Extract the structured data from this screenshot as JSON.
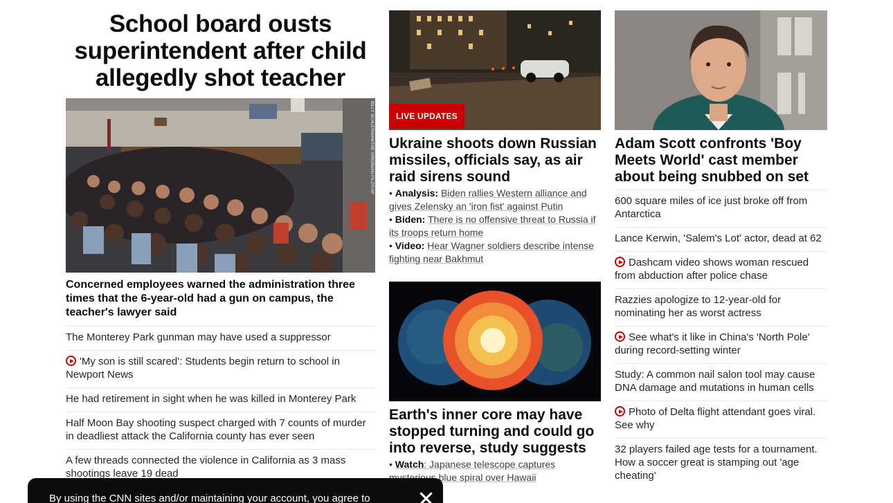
{
  "lead": {
    "headline": "School board ousts superintendent after child allegedly shot teacher",
    "photo_credit": "BILLY SCHUERMAN/THE VIRGINIAN-PILOT/AP",
    "subhead": "Concerned employees warned the administration three times that the 6-year-old had a gun on campus, the teacher's lawyer said",
    "links": [
      {
        "text": "The Monterey Park gunman may have used a suppressor",
        "video": false
      },
      {
        "text": "'My son is still scared': Students begin return to school in Newport News",
        "video": true
      },
      {
        "text": "He had retirement in sight when he was killed in Monterey Park",
        "video": false
      },
      {
        "text": "Half Moon Bay shooting suspect charged with 7 counts of murder in deadliest attack the California county has ever seen",
        "video": false
      },
      {
        "text": "A few threads connected the violence in California as 3 mass shootings leave 19 dead",
        "video": false
      }
    ]
  },
  "ukraine": {
    "badge": "LIVE UPDATES",
    "headline": "Ukraine shoots down Russian missiles, officials say, as air raid sirens sound",
    "bullets": [
      {
        "label": "Analysis:",
        "text": "Biden rallies Western alliance and gives Zelensky an 'iron fist' against Putin"
      },
      {
        "label": "Biden:",
        "text": "There is no offensive threat to Russia if its troops return home"
      },
      {
        "label": "Video:",
        "text": "Hear Wagner soldiers describe intense fighting near Bakhmut"
      }
    ]
  },
  "earth": {
    "headline": "Earth's inner core may have stopped turning and could go into reverse, study suggests",
    "bullet_label": "Watch",
    "bullet_text": ": Japanese telescope captures mysterious blue spiral over Hawaii"
  },
  "scott": {
    "headline": "Adam Scott confronts 'Boy Meets World' cast member about being snubbed on set",
    "links": [
      {
        "text": "600 square miles of ice just broke off from Antarctica",
        "video": false
      },
      {
        "text": "Lance Kerwin, 'Salem's Lot' actor, dead at 62",
        "video": false
      },
      {
        "text": "Dashcam video shows woman rescued from abduction after police chase",
        "video": true
      },
      {
        "text": "Razzies apologize to 12-year-old for nominating her as worst actress",
        "video": false
      },
      {
        "text": "See what's it like in China's 'North Pole' during record-setting winter",
        "video": true
      },
      {
        "text": "Study: A common nail salon tool may cause DNA damage and mutations in human cells",
        "video": false
      },
      {
        "text": "Photo of Delta flight attendant goes viral. See why",
        "video": true
      },
      {
        "text": "32 players failed age tests for a tournament. How a soccer great is stamping out 'age cheating'",
        "video": false
      }
    ]
  },
  "cookie_banner": {
    "text": "By using the CNN sites and/or maintaining your account, you agree to"
  },
  "colors": {
    "accent": "#cc0000",
    "text": "#0c0c0c",
    "divider": "#e6e6e6",
    "banner": "#0c0c0c"
  }
}
